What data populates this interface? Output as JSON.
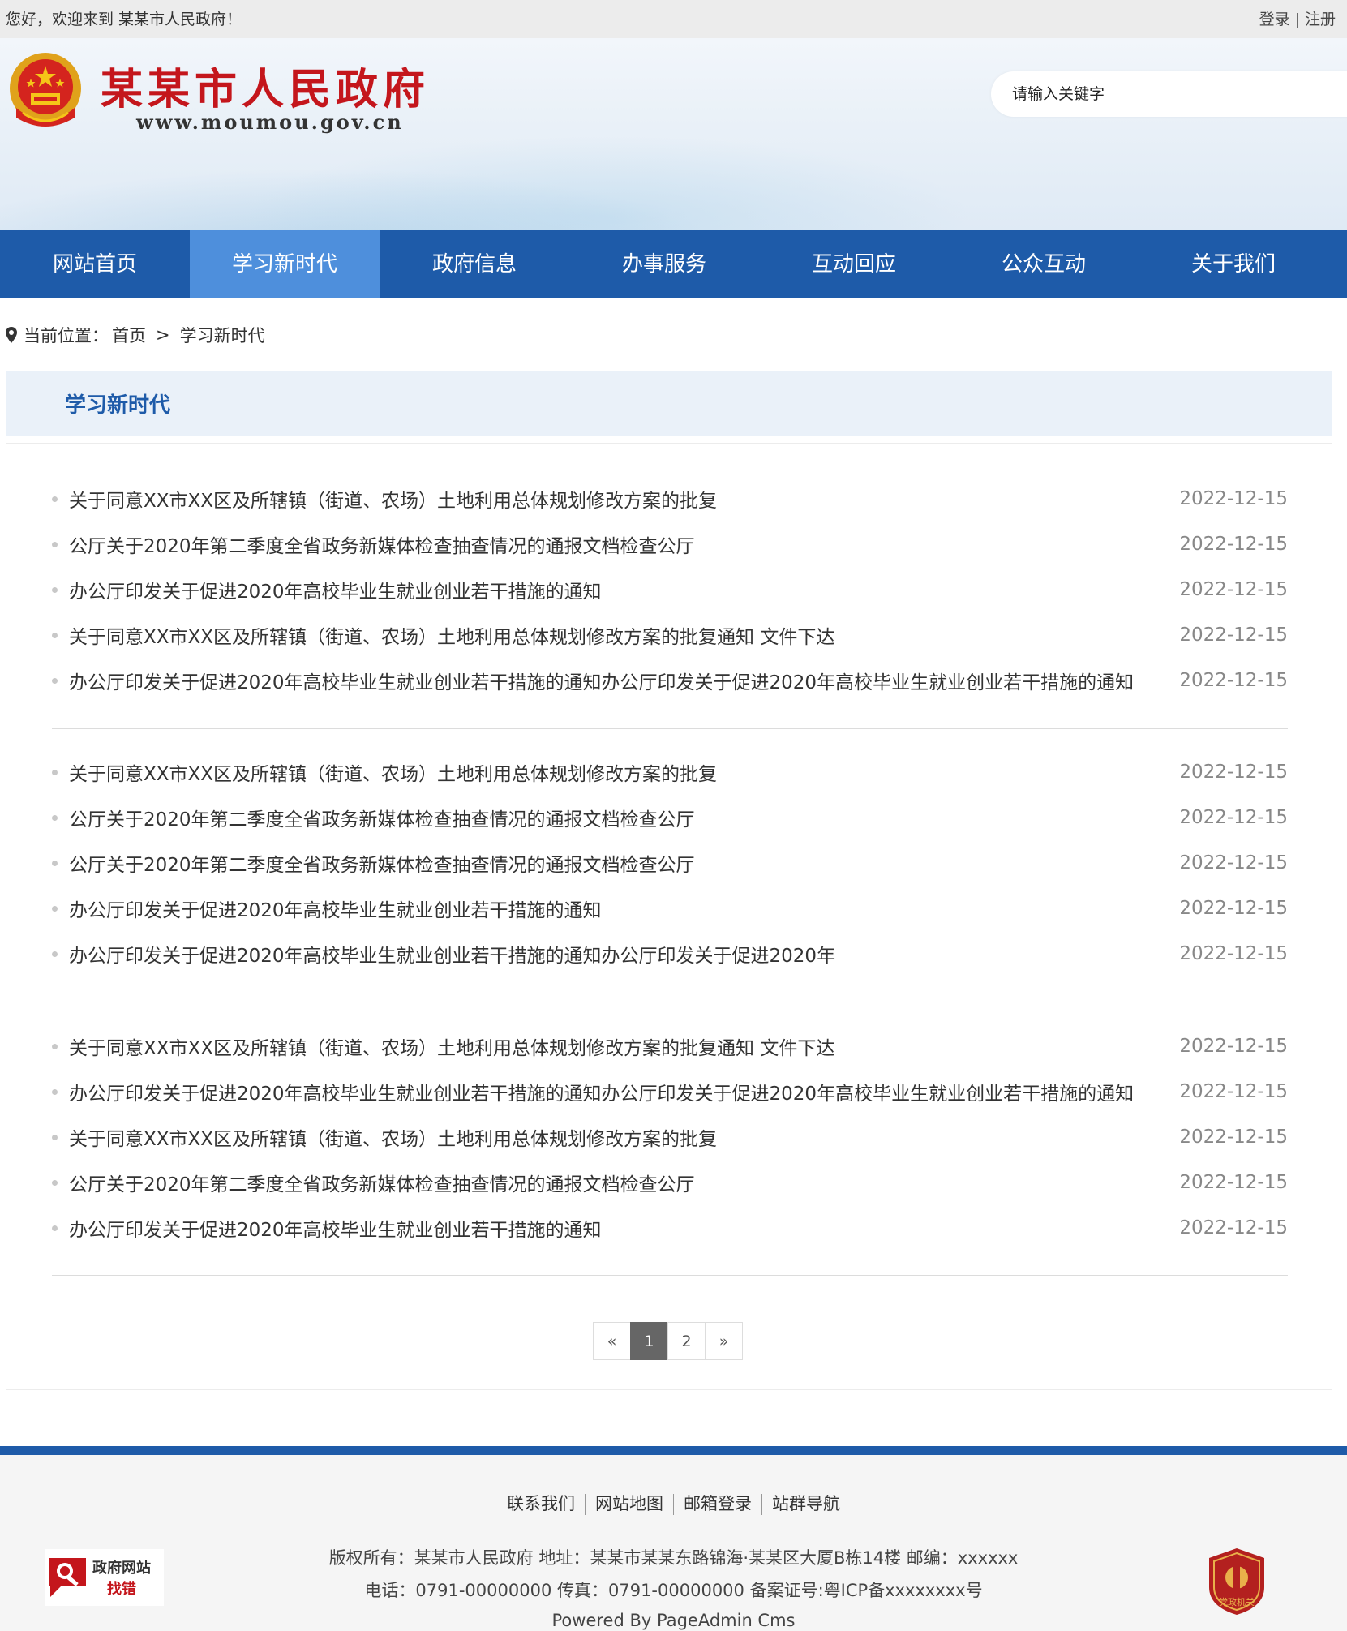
{
  "topbar": {
    "welcome": "您好，欢迎来到 某某市人民政府！",
    "login": "登录",
    "separator": "|",
    "register": "注册"
  },
  "header": {
    "site_name": "某某市人民政府",
    "site_url": "www.moumou.gov.cn",
    "search_placeholder": "请输入关键字",
    "emblem_icon": "national-emblem-icon"
  },
  "nav": {
    "items": [
      {
        "label": "网站首页",
        "active": false
      },
      {
        "label": "学习新时代",
        "active": true
      },
      {
        "label": "政府信息",
        "active": false
      },
      {
        "label": "办事服务",
        "active": false
      },
      {
        "label": "互动回应",
        "active": false
      },
      {
        "label": "公众互动",
        "active": false
      },
      {
        "label": "关于我们",
        "active": false
      }
    ]
  },
  "breadcrumb": {
    "prefix": "当前位置：",
    "home": "首页",
    "separator": ">",
    "current": "学习新时代"
  },
  "section": {
    "title": "学习新时代"
  },
  "article_groups": [
    [
      {
        "title": "关于同意XX市XX区及所辖镇（街道、农场）土地利用总体规划修改方案的批复",
        "date": "2022-12-15"
      },
      {
        "title": "公厅关于2020年第二季度全省政务新媒体检查抽查情况的通报文档检查公厅",
        "date": "2022-12-15"
      },
      {
        "title": "办公厅印发关于促进2020年高校毕业生就业创业若干措施的通知",
        "date": "2022-12-15"
      },
      {
        "title": "关于同意XX市XX区及所辖镇（街道、农场）土地利用总体规划修改方案的批复通知 文件下达",
        "date": "2022-12-15"
      },
      {
        "title": "办公厅印发关于促进2020年高校毕业生就业创业若干措施的通知办公厅印发关于促进2020年高校毕业生就业创业若干措施的通知",
        "date": "2022-12-15"
      }
    ],
    [
      {
        "title": "关于同意XX市XX区及所辖镇（街道、农场）土地利用总体规划修改方案的批复",
        "date": "2022-12-15"
      },
      {
        "title": "公厅关于2020年第二季度全省政务新媒体检查抽查情况的通报文档检查公厅",
        "date": "2022-12-15"
      },
      {
        "title": "公厅关于2020年第二季度全省政务新媒体检查抽查情况的通报文档检查公厅",
        "date": "2022-12-15"
      },
      {
        "title": "办公厅印发关于促进2020年高校毕业生就业创业若干措施的通知",
        "date": "2022-12-15"
      },
      {
        "title": "办公厅印发关于促进2020年高校毕业生就业创业若干措施的通知办公厅印发关于促进2020年",
        "date": "2022-12-15"
      }
    ],
    [
      {
        "title": "关于同意XX市XX区及所辖镇（街道、农场）土地利用总体规划修改方案的批复通知 文件下达",
        "date": "2022-12-15"
      },
      {
        "title": "办公厅印发关于促进2020年高校毕业生就业创业若干措施的通知办公厅印发关于促进2020年高校毕业生就业创业若干措施的通知",
        "date": "2022-12-15"
      },
      {
        "title": "关于同意XX市XX区及所辖镇（街道、农场）土地利用总体规划修改方案的批复",
        "date": "2022-12-15"
      },
      {
        "title": "公厅关于2020年第二季度全省政务新媒体检查抽查情况的通报文档检查公厅",
        "date": "2022-12-15"
      },
      {
        "title": "办公厅印发关于促进2020年高校毕业生就业创业若干措施的通知",
        "date": "2022-12-15"
      }
    ]
  ],
  "pagination": {
    "prev": "«",
    "pages": [
      "1",
      "2"
    ],
    "current": "1",
    "next": "»"
  },
  "footer": {
    "links": [
      "联系我们",
      "网站地图",
      "邮箱登录",
      "站群导航"
    ],
    "line1": "版权所有：某某市人民政府 地址：某某市某某东路锦海·某某区大厦B栋14楼 邮编：xxxxxx",
    "line2": "电话：0791-00000000 传真：0791-00000000 备案证号:粤ICP备xxxxxxxx号",
    "line3": "Powered By PageAdmin Cms",
    "find_error_line1": "政府网站",
    "find_error_line2": "找错",
    "party_badge_text": "党政机关"
  },
  "colors": {
    "nav_bg": "#1e5ba9",
    "nav_active": "#4e8fdc",
    "brand_red": "#c4161c",
    "section_bg": "#eaf1f9"
  }
}
